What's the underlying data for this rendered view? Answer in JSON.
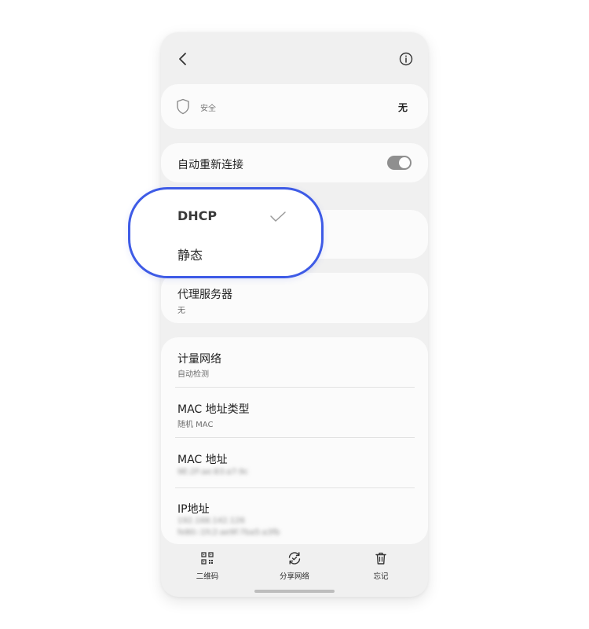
{
  "security": {
    "label": "安全",
    "value": "无"
  },
  "auto_reconnect": {
    "label": "自动重新连接",
    "enabled": true
  },
  "ip_settings_menu": {
    "options": [
      "DHCP",
      "静态"
    ],
    "selected": "DHCP"
  },
  "proxy": {
    "title": "代理服务器",
    "value": "无"
  },
  "metered": {
    "title": "计量网络",
    "value": "自动检测"
  },
  "mac_type": {
    "title": "MAC 地址类型",
    "value": "随机 MAC"
  },
  "mac_address": {
    "title": "MAC 地址",
    "value": "9E:2F:ae:83:a7:9c"
  },
  "ip_address": {
    "title": "IP地址",
    "ipv4": "192.168.142.126",
    "ipv6": "fe80::1fc2:ae9f:7ba5:a3fb"
  },
  "bottom_bar": {
    "qr_label": "二维码",
    "share_label": "分享网络",
    "forget_label": "忘记"
  },
  "colors": {
    "highlight": "#3e5be6",
    "toggle_track": "#8f8f8f"
  },
  "icons": [
    "back-arrow-icon",
    "info-icon",
    "shield-icon",
    "checkmark-icon",
    "qr-code-icon",
    "share-network-icon",
    "trash-icon"
  ]
}
